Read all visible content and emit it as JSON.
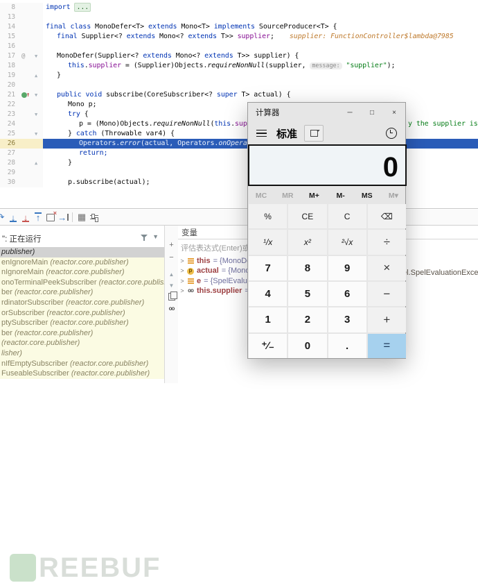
{
  "editor": {
    "lines": [
      {
        "num": "8",
        "ind": 0,
        "tokens": [
          {
            "t": "import ",
            "c": "kw"
          },
          {
            "t": "...",
            "c": "fold"
          }
        ]
      },
      {
        "num": "13",
        "ind": 0,
        "tokens": []
      },
      {
        "num": "14",
        "ind": 0,
        "tokens": [
          {
            "t": "final class ",
            "c": "kw"
          },
          {
            "t": "MonoDefer<T> ",
            "c": "pl"
          },
          {
            "t": "extends ",
            "c": "kw"
          },
          {
            "t": "Mono<T> ",
            "c": "pl"
          },
          {
            "t": "implements ",
            "c": "kw"
          },
          {
            "t": "SourceProducer<T> {",
            "c": "pl"
          }
        ]
      },
      {
        "num": "15",
        "ind": 1,
        "tokens": [
          {
            "t": "final ",
            "c": "kw"
          },
          {
            "t": "Supplier<? ",
            "c": "pl"
          },
          {
            "t": "extends ",
            "c": "kw"
          },
          {
            "t": "Mono<? ",
            "c": "pl"
          },
          {
            "t": "extends ",
            "c": "kw"
          },
          {
            "t": "T>> ",
            "c": "pl"
          },
          {
            "t": "supplier",
            "c": "fld"
          },
          {
            "t": ";",
            "c": "pl"
          },
          {
            "t": "supplier: FunctionController$lambda@7985",
            "c": "ival"
          }
        ]
      },
      {
        "num": "16",
        "ind": 0,
        "tokens": []
      },
      {
        "num": "17",
        "ind": 1,
        "gut": "at",
        "fold": "v",
        "tokens": [
          {
            "t": "MonoDefer(Supplier<? ",
            "c": "pl"
          },
          {
            "t": "extends ",
            "c": "kw"
          },
          {
            "t": "Mono<? ",
            "c": "pl"
          },
          {
            "t": "extends ",
            "c": "kw"
          },
          {
            "t": "T>> supplier) {",
            "c": "pl"
          }
        ]
      },
      {
        "num": "18",
        "ind": 2,
        "tokens": [
          {
            "t": "this",
            "c": "kw"
          },
          {
            "t": ".",
            "c": "pl"
          },
          {
            "t": "supplier",
            "c": "fld"
          },
          {
            "t": " = (Supplier)Objects.",
            "c": "pl"
          },
          {
            "t": "requireNonNull",
            "c": "mi"
          },
          {
            "t": "(supplier, ",
            "c": "pl"
          },
          {
            "t": "message:",
            "c": "hint"
          },
          {
            "t": " ",
            "c": "pl"
          },
          {
            "t": "\"supplier\"",
            "c": "str"
          },
          {
            "t": ");",
            "c": "pl"
          }
        ]
      },
      {
        "num": "19",
        "ind": 1,
        "fold": "^",
        "tokens": [
          {
            "t": "}",
            "c": "pl"
          }
        ]
      },
      {
        "num": "20",
        "ind": 0,
        "tokens": []
      },
      {
        "num": "21",
        "ind": 1,
        "gut": "bp",
        "fold": "v",
        "tokens": [
          {
            "t": "public void ",
            "c": "kw"
          },
          {
            "t": "subscribe(CoreSubscriber<? ",
            "c": "pl"
          },
          {
            "t": "super ",
            "c": "kw"
          },
          {
            "t": "T> actual) {",
            "c": "pl"
          }
        ]
      },
      {
        "num": "22",
        "ind": 2,
        "tokens": [
          {
            "t": "Mono p;",
            "c": "pl"
          }
        ]
      },
      {
        "num": "23",
        "ind": 2,
        "fold": "v",
        "tokens": [
          {
            "t": "try ",
            "c": "kw"
          },
          {
            "t": "{",
            "c": "pl"
          }
        ]
      },
      {
        "num": "24",
        "ind": 3,
        "tokens": [
          {
            "t": "p = (Mono)Objects.",
            "c": "pl"
          },
          {
            "t": "requireNonNull",
            "c": "mi"
          },
          {
            "t": "(",
            "c": "pl"
          },
          {
            "t": "this",
            "c": "kw"
          },
          {
            "t": ".",
            "c": "pl"
          },
          {
            "t": "suppl",
            "c": "fld"
          }
        ],
        "tail": "y the supplier is nu"
      },
      {
        "num": "25",
        "ind": 2,
        "fold": "v",
        "tokens": [
          {
            "t": "} ",
            "c": "pl"
          },
          {
            "t": "catch ",
            "c": "kw"
          },
          {
            "t": "(Throwable var4) {",
            "c": "pl"
          }
        ]
      },
      {
        "num": "26",
        "ind": 3,
        "exec": true,
        "tokens": [
          {
            "t": "Operators.",
            "c": "pl"
          },
          {
            "t": "error",
            "c": "mi"
          },
          {
            "t": "(actual, Operators.",
            "c": "pl"
          },
          {
            "t": "onOperato",
            "c": "mi"
          }
        ]
      },
      {
        "num": "27",
        "ind": 3,
        "tokens": [
          {
            "t": "return;",
            "c": "kw"
          }
        ]
      },
      {
        "num": "28",
        "ind": 2,
        "fold": "^",
        "tokens": [
          {
            "t": "}",
            "c": "pl"
          }
        ]
      },
      {
        "num": "29",
        "ind": 0,
        "tokens": []
      },
      {
        "num": "30",
        "ind": 2,
        "tokens": [
          {
            "t": "p.subscribe(actual);",
            "c": "pl"
          }
        ]
      }
    ]
  },
  "debug": {
    "toolbar": [
      "step-over",
      "step-into",
      "force-step-into",
      "step-out",
      "drop-frame",
      "run-to-cursor",
      "divider",
      "evaluate-expression",
      "layout-settings"
    ],
    "frames": {
      "header": "\": 正在运行",
      "rows": [
        {
          "name": "",
          "pkg": "publisher)",
          "selected": true
        },
        {
          "name": "enIgnoreMain ",
          "pkg": "(reactor.core.publisher)"
        },
        {
          "name": "nIgnoreMain ",
          "pkg": "(reactor.core.publisher)"
        },
        {
          "name": "onoTerminalPeekSubscriber ",
          "pkg": "(reactor.core.publisher)"
        },
        {
          "name": "ber ",
          "pkg": "(reactor.core.publisher)"
        },
        {
          "name": "rdinatorSubscriber ",
          "pkg": "(reactor.core.publisher)"
        },
        {
          "name": "orSubscriber ",
          "pkg": "(reactor.core.publisher)"
        },
        {
          "name": "ptySubscriber ",
          "pkg": "(reactor.core.publisher)"
        },
        {
          "name": "ber ",
          "pkg": "(reactor.core.publisher)"
        },
        {
          "name": "",
          "pkg": "(reactor.core.publisher)"
        },
        {
          "name": "",
          "pkg": "lisher)"
        },
        {
          "name": "nIfEmptySubscriber ",
          "pkg": "(reactor.core.publisher)"
        },
        {
          "name": "FuseableSubscriber ",
          "pkg": "(reactor.core.publisher)"
        }
      ]
    },
    "variables": {
      "title": "变量",
      "input_placeholder": "评估表达式(Enter)或添加",
      "rows": [
        {
          "icon": "fields",
          "name": "this",
          "value": "= {MonoDefe"
        },
        {
          "icon": "parameter",
          "name": "actual",
          "value": "= {MonoIg"
        },
        {
          "icon": "fields",
          "name": "e",
          "value": "= {SpelEvaluatio"
        },
        {
          "icon": "watch",
          "name": "this.supplier",
          "value": "= {Fu"
        }
      ],
      "overflow_text": "el.SpelEvaluationException"
    }
  },
  "calculator": {
    "title": "计算器",
    "window_controls": {
      "minimize": "─",
      "maximize": "□",
      "close": "×"
    },
    "mode": "标准",
    "display": "0",
    "memory": [
      {
        "label": "MC",
        "disabled": true
      },
      {
        "label": "MR",
        "disabled": true
      },
      {
        "label": "M+",
        "disabled": false
      },
      {
        "label": "M-",
        "disabled": false
      },
      {
        "label": "MS",
        "disabled": false
      },
      {
        "label": "M▾",
        "disabled": true
      }
    ],
    "keys": [
      [
        {
          "label": "%",
          "type": "fn"
        },
        {
          "label": "CE",
          "type": "fn"
        },
        {
          "label": "C",
          "type": "fn"
        },
        {
          "label": "⌫",
          "type": "fn"
        }
      ],
      [
        {
          "label": "¹/x",
          "type": "fn2"
        },
        {
          "label": "x²",
          "type": "fn2"
        },
        {
          "label": "²√x",
          "type": "fn2"
        },
        {
          "label": "÷",
          "type": "op"
        }
      ],
      [
        {
          "label": "7",
          "type": "dg"
        },
        {
          "label": "8",
          "type": "dg"
        },
        {
          "label": "9",
          "type": "dg"
        },
        {
          "label": "×",
          "type": "op"
        }
      ],
      [
        {
          "label": "4",
          "type": "dg"
        },
        {
          "label": "5",
          "type": "dg"
        },
        {
          "label": "6",
          "type": "dg"
        },
        {
          "label": "−",
          "type": "op"
        }
      ],
      [
        {
          "label": "1",
          "type": "dg"
        },
        {
          "label": "2",
          "type": "dg"
        },
        {
          "label": "3",
          "type": "dg"
        },
        {
          "label": "+",
          "type": "op"
        }
      ],
      [
        {
          "label": "⁺∕₋",
          "type": "dg"
        },
        {
          "label": "0",
          "type": "dg"
        },
        {
          "label": ".",
          "type": "dg"
        },
        {
          "label": "=",
          "type": "eq"
        }
      ]
    ]
  },
  "watermark": {
    "letters": "REEBUF"
  },
  "colors": {
    "exec_line": "#2A5CB8",
    "accent_blue": "#3876BF",
    "frames_bg": "#FBFBE3",
    "equals_bg": "#A6D1EE"
  }
}
